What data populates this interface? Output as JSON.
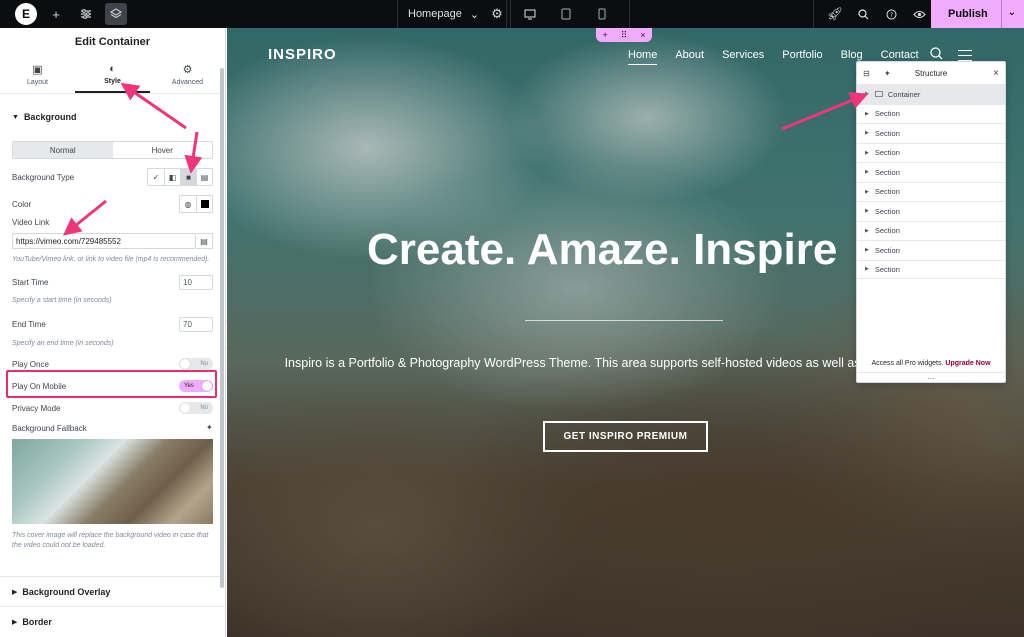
{
  "topbar": {
    "logo": "E",
    "page_name": "Homepage",
    "publish_label": "Publish"
  },
  "panel": {
    "title": "Edit Container",
    "tabs": [
      {
        "label": "Layout",
        "icon": "layout-icon"
      },
      {
        "label": "Style",
        "icon": "style-icon"
      },
      {
        "label": "Advanced",
        "icon": "gear-icon"
      }
    ],
    "background": {
      "heading": "Background",
      "state_normal": "Normal",
      "state_hover": "Hover",
      "type_label": "Background Type",
      "color_label": "Color",
      "video_link_label": "Video Link",
      "video_link_value": "https://vimeo.com/729485552",
      "video_link_hint": "YouTube/Vimeo link, or link to video file (mp4 is recommended).",
      "start_time_label": "Start Time",
      "start_time_value": "10",
      "start_time_hint": "Specify a start time (in seconds)",
      "end_time_label": "End Time",
      "end_time_value": "70",
      "end_time_hint": "Specify an end time (in seconds)",
      "play_once_label": "Play Once",
      "play_once_value": "No",
      "play_mobile_label": "Play On Mobile",
      "play_mobile_value": "Yes",
      "privacy_label": "Privacy Mode",
      "privacy_value": "No",
      "fallback_label": "Background Fallback",
      "fallback_hint": "This cover image will replace the background video in case that the video could not be loaded."
    },
    "overlay_heading": "Background Overlay",
    "border_heading": "Border"
  },
  "canvas": {
    "logo": "INSPIRO",
    "nav": [
      "Home",
      "About",
      "Services",
      "Portfolio",
      "Blog",
      "Contact"
    ],
    "hero_title": "Create. Amaze. Inspire",
    "hero_text": "Inspiro is a Portfolio & Photography WordPress Theme. This area supports self-hosted videos as well as YouTube and Vimeo.",
    "hero_button": "GET INSPIRO PREMIUM"
  },
  "structure": {
    "title": "Structure",
    "items": [
      "Container",
      "Section",
      "Section",
      "Section",
      "Section",
      "Section",
      "Section",
      "Section",
      "Section",
      "Section"
    ],
    "footer_text": "Access all Pro widgets.",
    "footer_link": "Upgrade Now",
    "more": "..."
  },
  "colors": {
    "accent_pink": "#f0abfc",
    "annotation_arrow": "#f0367a",
    "highlight_border": "#e3316f",
    "topbar_bg": "#0c0d0e"
  }
}
